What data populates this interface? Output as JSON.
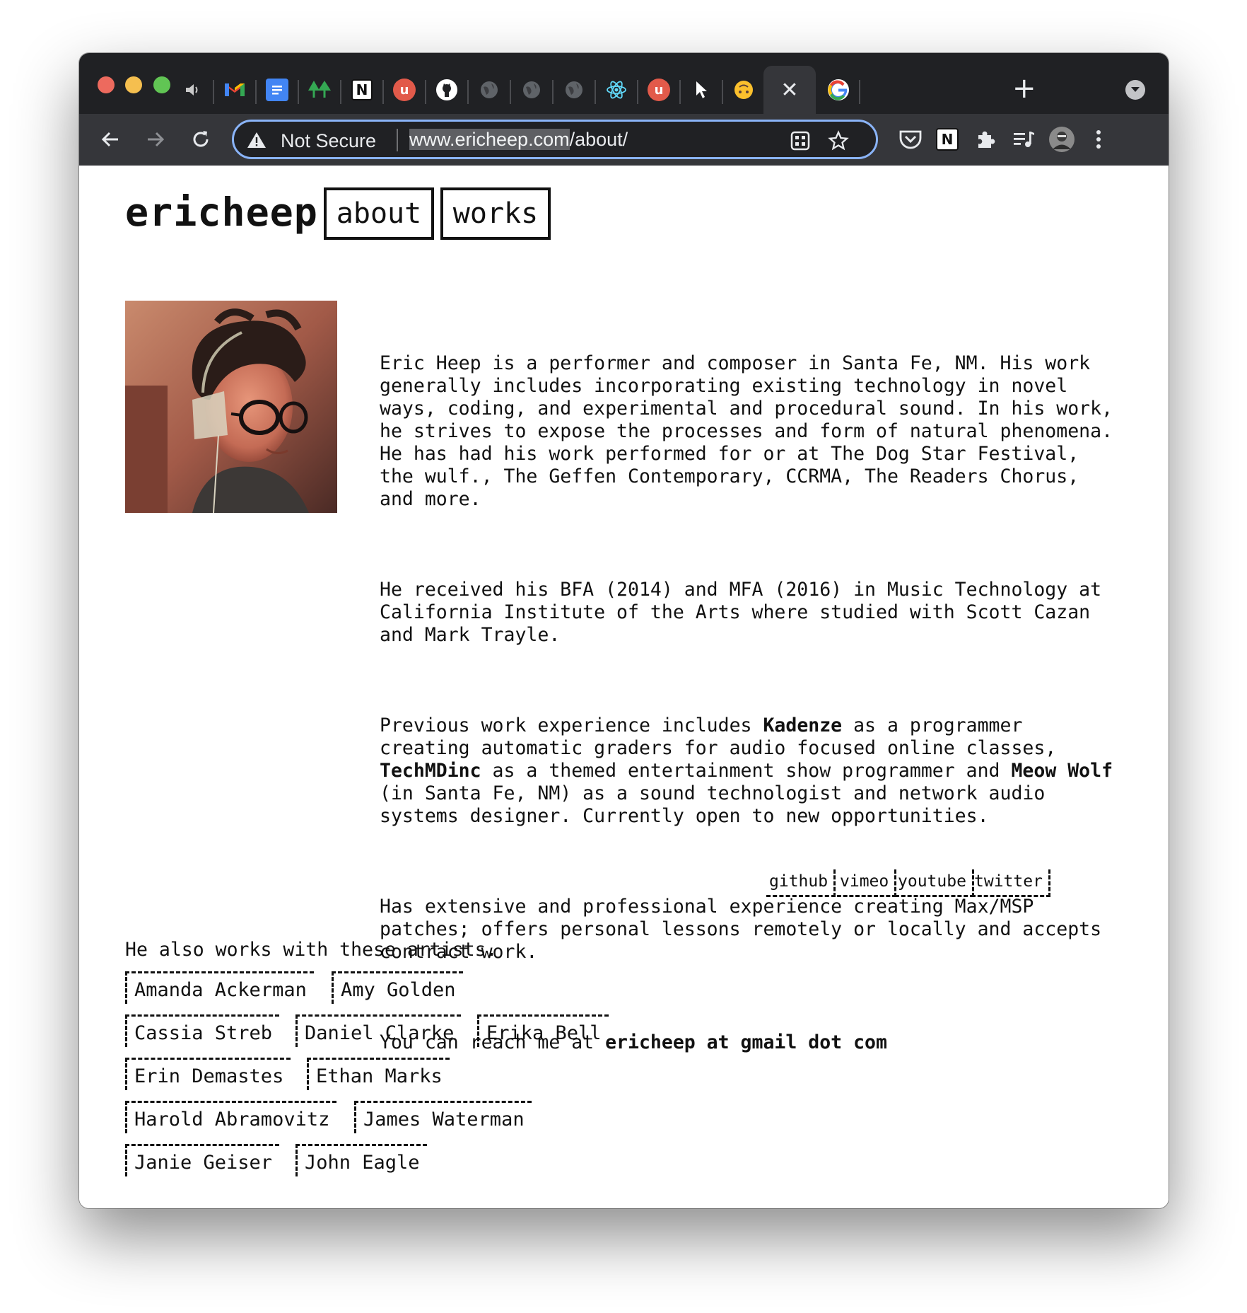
{
  "browser": {
    "tabs": [
      {
        "name": "audio-tab",
        "icon": "speaker-icon"
      },
      {
        "name": "gmail-tab",
        "icon": "gmail-icon"
      },
      {
        "name": "google-docs-tab",
        "icon": "docs-icon"
      },
      {
        "name": "trees-tab",
        "icon": "trees-icon"
      },
      {
        "name": "notion-tab",
        "icon": "notion-icon"
      },
      {
        "name": "u-app-tab",
        "icon": "u-app-icon"
      },
      {
        "name": "github-tab",
        "icon": "github-icon"
      },
      {
        "name": "globe-tab-1",
        "icon": "globe-icon"
      },
      {
        "name": "globe-tab-2",
        "icon": "globe-icon"
      },
      {
        "name": "globe-tab-3",
        "icon": "globe-icon"
      },
      {
        "name": "react-tab",
        "icon": "react-icon"
      },
      {
        "name": "u-app-tab-2",
        "icon": "u-app-icon"
      },
      {
        "name": "cursor-tab",
        "icon": "cursor-icon"
      },
      {
        "name": "emoji-tab",
        "icon": "upside-down-face-icon"
      }
    ],
    "active_tab_icon": "close-icon",
    "google_tab_icon": "google-icon",
    "new_tab": "+",
    "address_bar": {
      "security_label": "Not Secure",
      "url_highlight": "www.ericheep.com",
      "url_rest": "/about/"
    },
    "colors": {
      "tabstrip": "#202124",
      "toolbar": "#35363a",
      "focus_ring": "#8ab4f8"
    }
  },
  "site": {
    "brand": "ericheep",
    "nav": {
      "about": "about",
      "works": "works"
    },
    "bio": {
      "p1": "Eric Heep is a performer and composer in Santa Fe, NM. His work\ngenerally includes incorporating existing technology in novel\nways, coding, and experimental and procedural sound. In his work,\nhe strives to expose the processes and form of natural phenomena.\nHe has had his work performed for or at The Dog Star Festival,\nthe wulf., The Geffen Contemporary, CCRMA, The Readers Chorus,\nand more.",
      "p2": "He received his BFA (2014) and MFA (2016) in Music Technology at\nCalifornia Institute of the Arts where studied with Scott Cazan\nand Mark Trayle.",
      "p3_a": "Previous work experience includes ",
      "p3_kadenze": "Kadenze",
      "p3_b": " as a programmer\ncreating automatic graders for audio focused online classes,\n",
      "p3_techmd": "TechMDinc",
      "p3_c": " as a themed entertainment show programmer and ",
      "p3_meow": "Meow Wolf",
      "p3_d": "\n(in Santa Fe, NM) as a sound technologist and network audio\nsystems designer. Currently open to new opportunities.",
      "p4": "Has extensive and professional experience creating Max/MSP\npatches; offers personal lessons remotely or locally and accepts\ncontract work.",
      "p5_a": "You can reach me at ",
      "p5_email": "ericheep at gmail dot com"
    },
    "social": [
      "github",
      "vimeo",
      "youtube",
      "twitter"
    ],
    "artists_title": "He also works with these artists.",
    "artists": [
      "Amanda Ackerman",
      "Amy Golden",
      "Cassia Streb",
      "Daniel Clarke",
      "Erika Bell",
      "Erin Demastes",
      "Ethan Marks",
      "Harold Abramovitz",
      "James Waterman",
      "Janie Geiser",
      "John Eagle"
    ]
  }
}
